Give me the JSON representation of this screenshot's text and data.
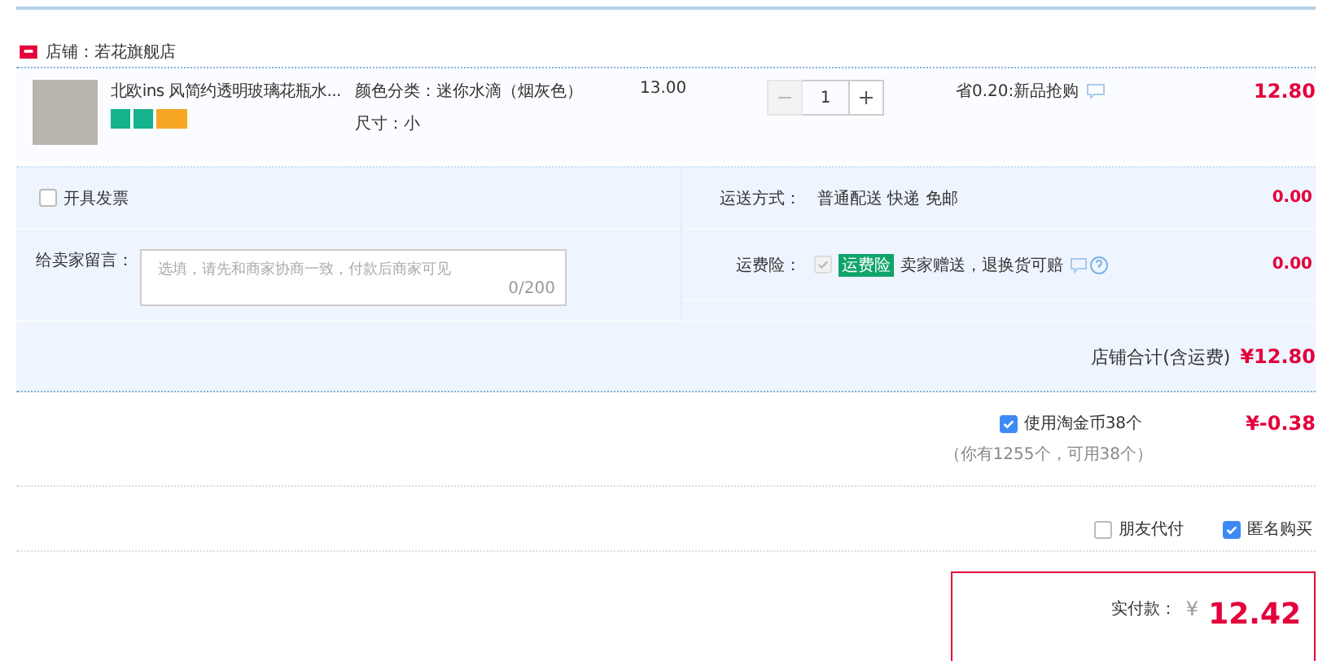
{
  "store": {
    "label": "店铺：若花旗舰店"
  },
  "item": {
    "title": "北欧ins 风简约透明玻璃花瓶水...",
    "specs": [
      "颜色分类：迷你水滴（烟灰色）",
      "尺寸：小"
    ],
    "unit_price": "13.00",
    "quantity": "1",
    "promo": "省0.20:新品抢购",
    "subtotal": "12.80"
  },
  "invoice": {
    "label": "开具发票",
    "checked": false
  },
  "shipping": {
    "label": "运送方式：",
    "value": "普通配送 快递 免邮",
    "price": "0.00"
  },
  "message": {
    "label": "给卖家留言：",
    "placeholder": "选填，请先和商家协商一致，付款后商家可见",
    "counter": "0/200"
  },
  "insurance": {
    "label": "运费险：",
    "checked": true,
    "badge": "运费险",
    "text": "卖家赠送，退换货可赔",
    "price": "0.00"
  },
  "store_total": {
    "label": "店铺合计(含运费)",
    "value": "¥12.80"
  },
  "coins": {
    "label": "使用淘金币38个",
    "checked": true,
    "note": "（你有1255个，可用38个）",
    "value": "¥-0.38"
  },
  "options": [
    {
      "label": "朋友代付",
      "checked": false
    },
    {
      "label": "匿名购买",
      "checked": true
    }
  ],
  "payment": {
    "label": "实付款：",
    "currency": "¥",
    "value": "12.42"
  }
}
